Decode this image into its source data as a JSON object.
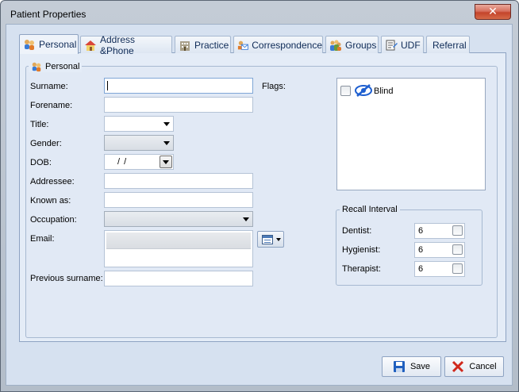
{
  "window": {
    "title": "Patient Properties"
  },
  "tabs": [
    {
      "label": "Personal",
      "icon": "people-icon"
    },
    {
      "label": "Address &Phone",
      "icon": "house-icon"
    },
    {
      "label": "Practice",
      "icon": "building-icon"
    },
    {
      "label": "Correspondence",
      "icon": "envelope-icon"
    },
    {
      "label": "Groups",
      "icon": "group-icon"
    },
    {
      "label": "UDF",
      "icon": "form-icon"
    },
    {
      "label": "Referral",
      "icon": ""
    }
  ],
  "personal_group": {
    "title": "Personal",
    "icon": "people-icon"
  },
  "form": {
    "surname_label": "Surname:",
    "surname_value": "",
    "forename_label": "Forename:",
    "forename_value": "",
    "title_label": "Title:",
    "title_value": "",
    "gender_label": "Gender:",
    "gender_value": "",
    "dob_label": "DOB:",
    "dob_value": "/ /",
    "addressee_label": "Addressee:",
    "addressee_value": "",
    "known_as_label": "Known as:",
    "known_as_value": "",
    "occupation_label": "Occupation:",
    "occupation_value": "",
    "email_label": "Email:",
    "email_value": "",
    "previous_surname_label": "Previous surname:",
    "previous_surname_value": ""
  },
  "flags": {
    "label": "Flags:",
    "items": [
      {
        "label": "Blind",
        "checked": false,
        "icon": "blind-eye-icon"
      }
    ]
  },
  "recall": {
    "title": "Recall Interval",
    "rows": [
      {
        "label": "Dentist:",
        "value": "6"
      },
      {
        "label": "Hygienist:",
        "value": "6"
      },
      {
        "label": "Therapist:",
        "value": "6"
      }
    ]
  },
  "buttons": {
    "save": "Save",
    "cancel": "Cancel"
  },
  "colors": {
    "client_bg": "#d6e1f0",
    "panel_bg": "#e4ecf7",
    "accent": "#0f2b57",
    "close_red": "#c4442b"
  }
}
